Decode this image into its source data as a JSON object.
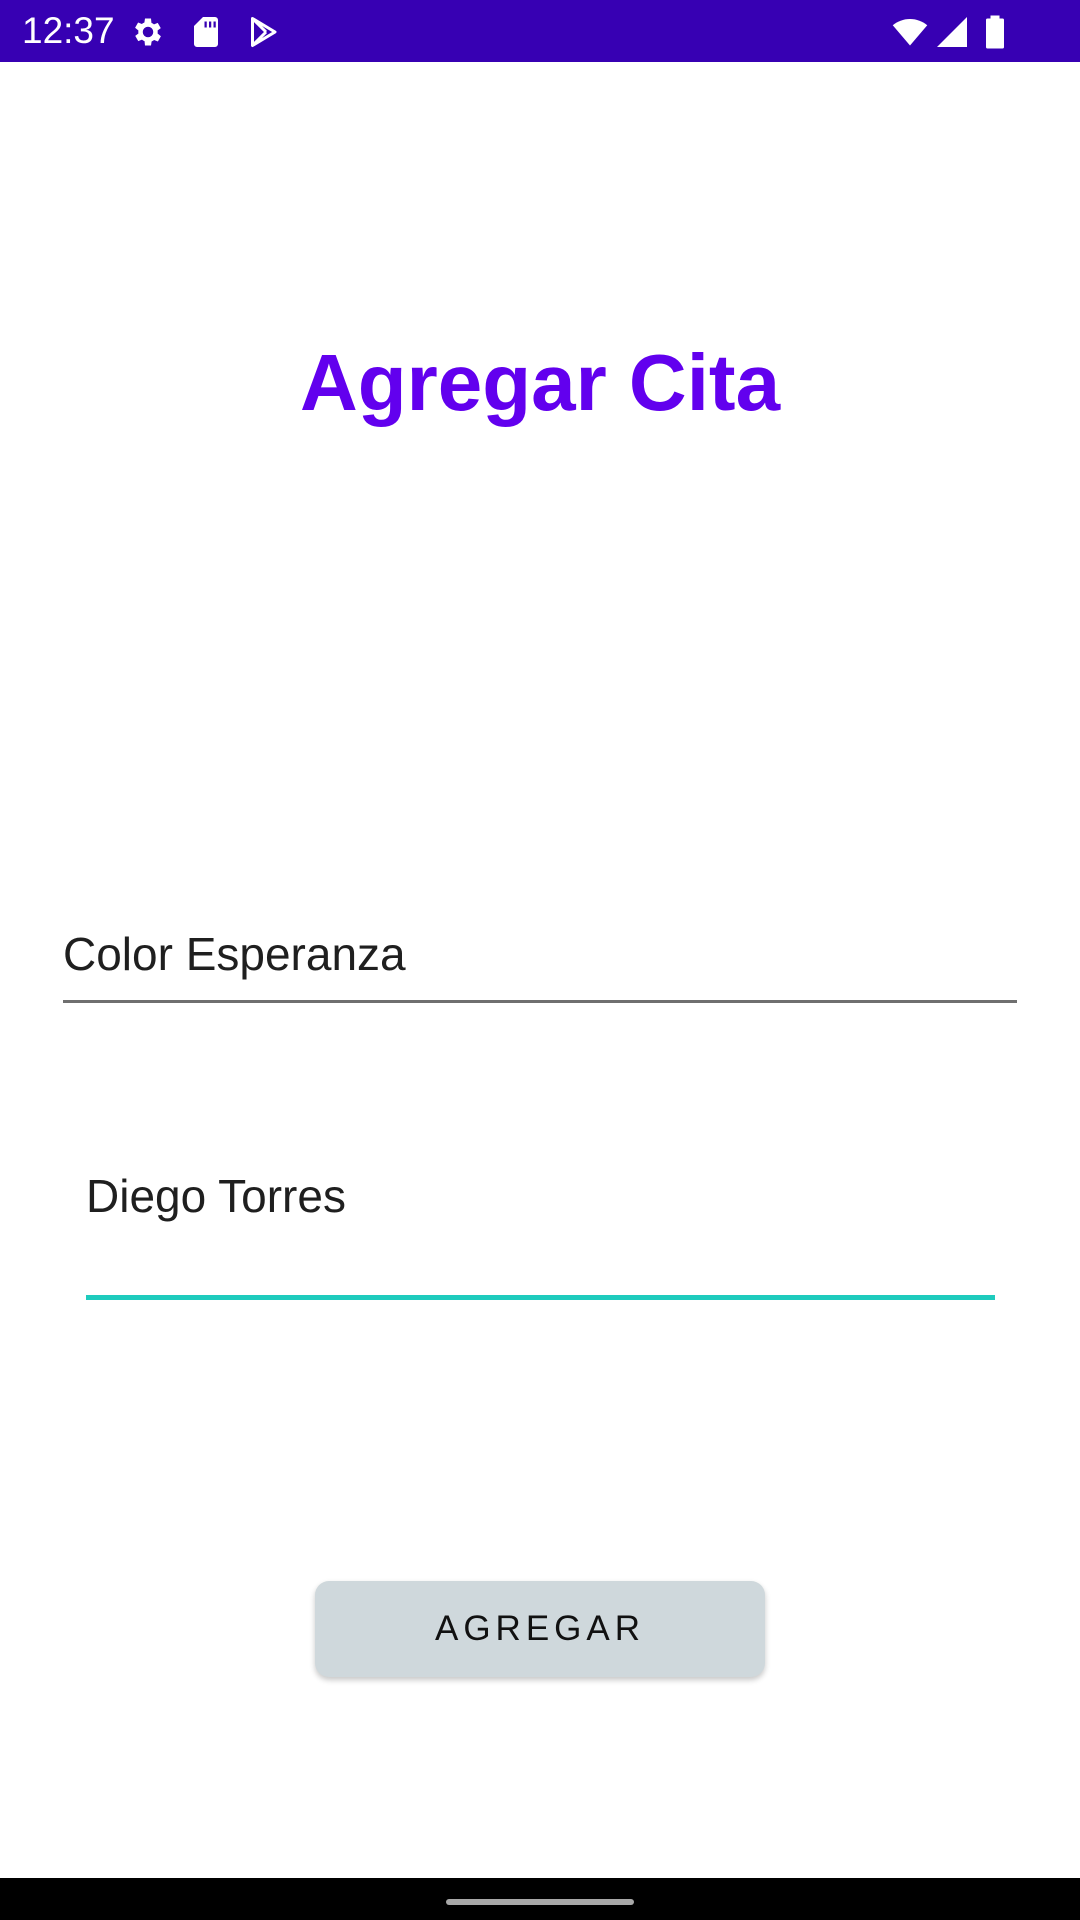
{
  "status_bar": {
    "time": "12:37",
    "background_color": "#3700b3",
    "icons_left": [
      "gear-icon",
      "sd-card-icon",
      "play-store-icon"
    ],
    "icons_right": [
      "wifi-icon",
      "signal-icon",
      "battery-icon"
    ]
  },
  "screen": {
    "title": "Agregar Cita",
    "title_color": "#6200ee"
  },
  "form": {
    "field1": {
      "value": "Color Esperanza"
    },
    "field2": {
      "value": "Diego Torres",
      "focused": true,
      "focus_color": "#1ecbbd"
    },
    "submit_label": "AGREGAR"
  }
}
